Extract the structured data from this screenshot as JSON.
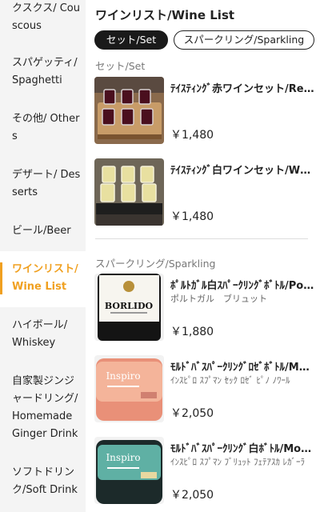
{
  "sidebar": {
    "items": [
      {
        "label": "クスクス/ Couscous"
      },
      {
        "label": "スパゲッティ/ Spaghetti"
      },
      {
        "label": "その他/ Others"
      },
      {
        "label": "デザート/ Desserts"
      },
      {
        "label": "ビール/Beer"
      },
      {
        "label": "ワインリスト/ Wine List"
      },
      {
        "label": "ハイボール/ Whiskey"
      },
      {
        "label": "自家製ジンジャードリング/ Homemade Ginger Drink"
      },
      {
        "label": "ソフトドリンク/Soft Drink"
      }
    ],
    "active_color": "#f0a020"
  },
  "main": {
    "title": "ワインリスト/Wine List",
    "tabs": [
      {
        "label": "セット/Set",
        "selected": true
      },
      {
        "label": "スパークリング/Sparkling",
        "selected": false
      }
    ],
    "sections": [
      {
        "title": "セット/Set",
        "items": [
          {
            "name": "ﾃｲｽﾃｨﾝｸﾞ赤ワインセット/Red Wine Set",
            "price": "￥1,480",
            "image": "red-wine-tasting-set"
          },
          {
            "name": "ﾃｲｽﾃｨﾝｸﾞ白ワインセット/White Wine Set",
            "price": "￥1,480",
            "image": "white-wine-tasting-set"
          }
        ]
      },
      {
        "title": "スパークリング/Sparkling",
        "items": [
          {
            "name": "ﾎﾟﾙﾄｶﾞﾙ白ｽﾊﾟｰｸﾘﾝｸﾞﾎﾞﾄﾙ/Portugal Sparkling",
            "sub": "ポルトガル　ブリュット",
            "price": "￥1,880",
            "image": "borlido-bottle",
            "label_text": "BORLIDO"
          },
          {
            "name": "ﾓﾙﾄﾞﾊﾞｽﾊﾟｰｸﾘﾝｸﾞﾛｾﾞﾎﾞﾄﾙ/Moldova Rose",
            "sub": "ｲﾝｽﾋﾟﾛ ｽﾌﾟﾏﾝ ｾｯｸ ﾛｾﾞ ﾋﾟﾉ ﾉﾜｰﾙ",
            "price": "￥2,050",
            "image": "inspiro-rose-bottle",
            "label_text": "Inspiro"
          },
          {
            "name": "ﾓﾙﾄﾞﾊﾞｽﾊﾟｰｸﾘﾝｸﾞ白ﾎﾞﾄﾙ/Moldova White",
            "sub": "ｲﾝｽﾋﾟﾛ ｽﾌﾟﾏﾝ ﾌﾞﾘｭｯﾄ ﾌｪﾃｱｽｶ ﾚｶﾞｰﾗ",
            "price": "￥2,050",
            "image": "inspiro-white-bottle",
            "label_text": "Inspiro"
          }
        ]
      }
    ]
  }
}
